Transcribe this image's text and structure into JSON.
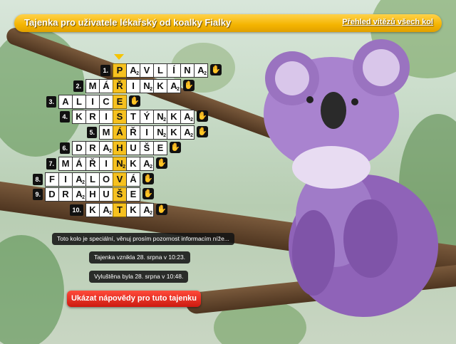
{
  "header": {
    "title": "Tajenka pro uživatele lékařský od koalky Fialky",
    "link": "Přehled vítězů všech kol"
  },
  "rows": [
    {
      "number": "1.",
      "cells": [
        {
          "l": "P",
          "key": true
        },
        {
          "l": "A",
          "s": "2"
        },
        {
          "l": "V"
        },
        {
          "l": "L"
        },
        {
          "l": "Í"
        },
        {
          "l": "N"
        },
        {
          "l": "A",
          "s": "2"
        }
      ]
    },
    {
      "number": "2.",
      "cells": [
        {
          "l": "M"
        },
        {
          "l": "Á"
        },
        {
          "l": "Ř",
          "key": true
        },
        {
          "l": "I"
        },
        {
          "l": "N",
          "s": "2"
        },
        {
          "l": "K"
        },
        {
          "l": "A",
          "s": "2"
        }
      ]
    },
    {
      "number": "3.",
      "cells": [
        {
          "l": "A"
        },
        {
          "l": "L"
        },
        {
          "l": "I"
        },
        {
          "l": "C"
        },
        {
          "l": "E",
          "key": true
        }
      ]
    },
    {
      "number": "4.",
      "cells": [
        {
          "l": "K"
        },
        {
          "l": "R"
        },
        {
          "l": "I"
        },
        {
          "l": "S",
          "key": true
        },
        {
          "l": "T"
        },
        {
          "l": "Ý"
        },
        {
          "l": "N",
          "s": "2"
        },
        {
          "l": "K"
        },
        {
          "l": "A",
          "s": "2"
        }
      ]
    },
    {
      "number": "5.",
      "cells": [
        {
          "l": "M"
        },
        {
          "l": "Á",
          "key": true
        },
        {
          "l": "Ř"
        },
        {
          "l": "I"
        },
        {
          "l": "N",
          "s": "2"
        },
        {
          "l": "K"
        },
        {
          "l": "A",
          "s": "2"
        }
      ]
    },
    {
      "number": "6.",
      "cells": [
        {
          "l": "D"
        },
        {
          "l": "R"
        },
        {
          "l": "A",
          "s": "2"
        },
        {
          "l": "H",
          "key": true
        },
        {
          "l": "U"
        },
        {
          "l": "Š"
        },
        {
          "l": "E"
        }
      ]
    },
    {
      "number": "7.",
      "cells": [
        {
          "l": "M"
        },
        {
          "l": "Á"
        },
        {
          "l": "Ř"
        },
        {
          "l": "I"
        },
        {
          "l": "N",
          "s": "2",
          "key": true
        },
        {
          "l": "K"
        },
        {
          "l": "A",
          "s": "2"
        }
      ]
    },
    {
      "number": "8.",
      "cells": [
        {
          "l": "F"
        },
        {
          "l": "I"
        },
        {
          "l": "A",
          "s": "2"
        },
        {
          "l": "L"
        },
        {
          "l": "O"
        },
        {
          "l": "V",
          "key": true
        },
        {
          "l": "Á"
        }
      ]
    },
    {
      "number": "9.",
      "cells": [
        {
          "l": "D"
        },
        {
          "l": "R"
        },
        {
          "l": "A",
          "s": "2"
        },
        {
          "l": "H"
        },
        {
          "l": "U"
        },
        {
          "l": "Š",
          "key": true
        },
        {
          "l": "E"
        }
      ]
    },
    {
      "number": "10.",
      "cells": [
        {
          "l": "K"
        },
        {
          "l": "A",
          "s": "2"
        },
        {
          "l": "T",
          "key": true
        },
        {
          "l": "K"
        },
        {
          "l": "A",
          "s": "2"
        }
      ]
    }
  ],
  "info": {
    "special": "Toto kolo je speciální, věnuj prosím pozornost informacím níže...",
    "created": "Tajenka vznikla 28. srpna v 10:23.",
    "solved": "Vyluštěna byla 28. srpna v 10:48."
  },
  "hint_button": "Ukázat nápovědy pro tuto tajenku",
  "colors": {
    "accent": "#f4b400",
    "button": "#cc1a10",
    "koala": "#9b6fc2"
  },
  "icons": {
    "row_end": "thumbs-up-icon",
    "marker": "down-arrow-marker-icon"
  }
}
